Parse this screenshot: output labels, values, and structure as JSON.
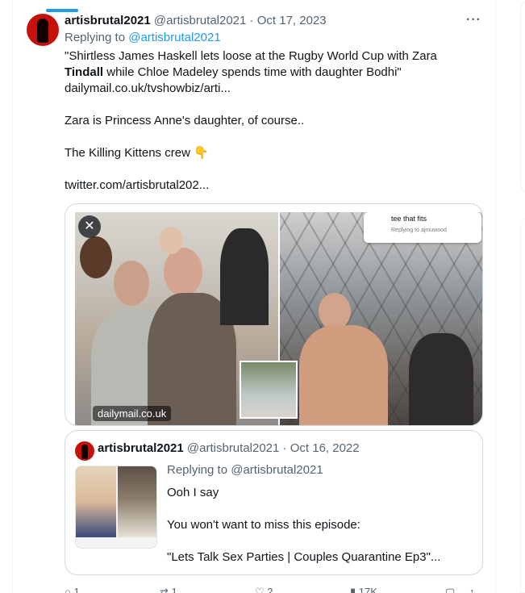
{
  "tweet": {
    "display_name": "artisbrutal2021",
    "handle": "@artisbrutal2021",
    "separator": "·",
    "date": "Oct 17, 2023",
    "replying_label": "Replying to",
    "replying_handle": "@artisbrutal2021",
    "headline_part1": "\"Shirtless James Haskell lets loose at the Rugby World Cup with Zara",
    "headline_bold": "Tindall",
    "headline_part2": " while Chloe Madeley spends time with daughter Bodhi\"",
    "link1": "dailymail.co.uk/tvshowbiz/arti...",
    "line_zara": "Zara is Princess Anne's daughter, of course..",
    "line_crew": "The Killing Kittens crew",
    "crew_emoji": "👇",
    "link2": "twitter.com/artisbrutal202...",
    "more_icon": "···"
  },
  "media": {
    "close_glyph": "✕",
    "source_badge": "dailymail.co.uk",
    "overlay_title": "tee that fits",
    "overlay_sub": "Replying to ajmuwood"
  },
  "quote": {
    "display_name": "artisbrutal2021",
    "handle": "@artisbrutal2021",
    "separator": "·",
    "date": "Oct 16, 2022",
    "replying_label": "Replying to",
    "replying_handle": "@artisbrutal2021",
    "line1": "Ooh I say",
    "line2": "You won't want to miss this episode:",
    "line3": "\"Lets Talk Sex Parties | Couples Quarantine Ep3\"..."
  },
  "actions": {
    "reply_count": "1",
    "retweet_count": "1",
    "like_count": "2",
    "views_count": "17K"
  },
  "colors": {
    "accent": "#1d9bf0",
    "muted": "#536471",
    "text": "#0f1419",
    "border": "#cfd9de"
  }
}
